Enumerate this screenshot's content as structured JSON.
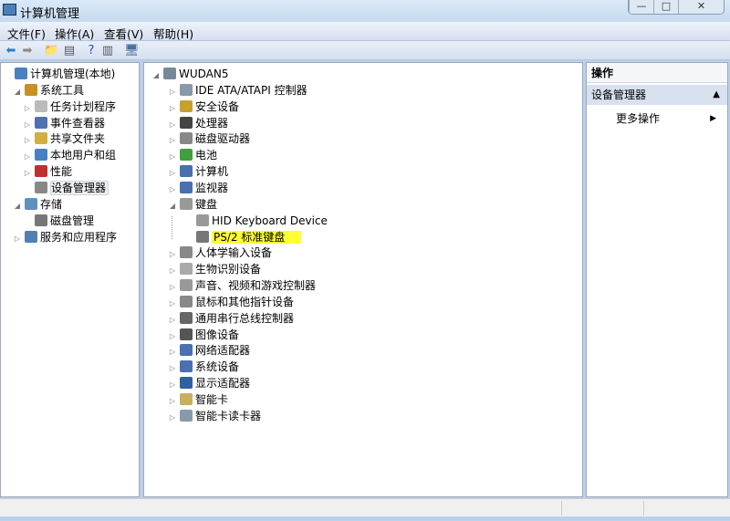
{
  "window": {
    "title": "计算机管理",
    "minimize": "—",
    "maximize": "□",
    "close": "✕"
  },
  "menu": [
    "文件(F)",
    "操作(A)",
    "查看(V)",
    "帮助(H)"
  ],
  "toolbar": [
    {
      "icon": "back-arrow-icon",
      "glyph": "⬅",
      "color": "#2a7fd0"
    },
    {
      "icon": "forward-arrow-icon",
      "glyph": "➡",
      "color": "#888888"
    },
    {
      "icon": "up-folder-icon",
      "glyph": "📁",
      "color": "#d8a030"
    },
    {
      "icon": "show-hide-console-tree-icon",
      "glyph": "▤",
      "color": "#556"
    },
    {
      "icon": "help-icon",
      "glyph": "?",
      "color": "#2b4fb0"
    },
    {
      "icon": "show-hide-action-pane-icon",
      "glyph": "▥",
      "color": "#556"
    },
    {
      "icon": "scan-hardware-icon",
      "glyph": "🖥",
      "color": "#4a6fa0"
    }
  ],
  "left_tree": [
    {
      "label": "计算机管理(本地)",
      "level": 0,
      "exp": "",
      "icon": "computer-management-icon",
      "color": "#4a7fc0"
    },
    {
      "label": "系统工具",
      "level": 1,
      "exp": "◢",
      "icon": "system-tools-icon",
      "color": "#c89020"
    },
    {
      "label": "任务计划程序",
      "level": 2,
      "exp": "▷",
      "icon": "task-scheduler-icon",
      "color": "#bbbbbb"
    },
    {
      "label": "事件查看器",
      "level": 2,
      "exp": "▷",
      "icon": "event-viewer-icon",
      "color": "#5070b0"
    },
    {
      "label": "共享文件夹",
      "level": 2,
      "exp": "▷",
      "icon": "shared-folders-icon",
      "color": "#d0b040"
    },
    {
      "label": "本地用户和组",
      "level": 2,
      "exp": "▷",
      "icon": "local-users-icon",
      "color": "#4a80c0"
    },
    {
      "label": "性能",
      "level": 2,
      "exp": "▷",
      "icon": "performance-icon",
      "color": "#c03030"
    },
    {
      "label": "设备管理器",
      "level": 2,
      "exp": "",
      "icon": "device-manager-icon",
      "color": "#888888",
      "selected": true
    },
    {
      "label": "存储",
      "level": 1,
      "exp": "◢",
      "icon": "storage-icon",
      "color": "#6090c0"
    },
    {
      "label": "磁盘管理",
      "level": 2,
      "exp": "",
      "icon": "disk-management-icon",
      "color": "#777777"
    },
    {
      "label": "服务和应用程序",
      "level": 1,
      "exp": "▷",
      "icon": "services-applications-icon",
      "color": "#5080b0"
    }
  ],
  "device_tree": [
    {
      "label": "WUDAN5",
      "level": 0,
      "exp": "◢",
      "icon": "computer-icon",
      "color": "#778899"
    },
    {
      "label": "IDE ATA/ATAPI 控制器",
      "level": 1,
      "exp": "▷",
      "icon": "ide-controller-icon",
      "color": "#8899aa"
    },
    {
      "label": "安全设备",
      "level": 1,
      "exp": "▷",
      "icon": "security-device-icon",
      "color": "#c8a030"
    },
    {
      "label": "处理器",
      "level": 1,
      "exp": "▷",
      "icon": "processor-icon",
      "color": "#444444"
    },
    {
      "label": "磁盘驱动器",
      "level": 1,
      "exp": "▷",
      "icon": "disk-drive-icon",
      "color": "#888888"
    },
    {
      "label": "电池",
      "level": 1,
      "exp": "▷",
      "icon": "battery-icon",
      "color": "#40a040"
    },
    {
      "label": "计算机",
      "level": 1,
      "exp": "▷",
      "icon": "computer-icon",
      "color": "#4a70b0"
    },
    {
      "label": "监视器",
      "level": 1,
      "exp": "▷",
      "icon": "monitor-icon",
      "color": "#4a70b0"
    },
    {
      "label": "键盘",
      "level": 1,
      "exp": "◢",
      "icon": "keyboard-icon",
      "color": "#999999"
    },
    {
      "label": "HID Keyboard Device",
      "level": 2,
      "exp": "",
      "icon": "keyboard-icon",
      "color": "#999999"
    },
    {
      "label": "PS/2 标准键盘",
      "level": 2,
      "exp": "",
      "icon": "keyboard-icon",
      "color": "#777777",
      "highlighted": true
    },
    {
      "label": "人体学输入设备",
      "level": 1,
      "exp": "▷",
      "icon": "hid-icon",
      "color": "#888888"
    },
    {
      "label": "生物识别设备",
      "level": 1,
      "exp": "▷",
      "icon": "biometric-icon",
      "color": "#aaaaaa"
    },
    {
      "label": "声音、视频和游戏控制器",
      "level": 1,
      "exp": "▷",
      "icon": "sound-icon",
      "color": "#999999"
    },
    {
      "label": "鼠标和其他指针设备",
      "level": 1,
      "exp": "▷",
      "icon": "mouse-icon",
      "color": "#888888"
    },
    {
      "label": "通用串行总线控制器",
      "level": 1,
      "exp": "▷",
      "icon": "usb-icon",
      "color": "#666666"
    },
    {
      "label": "图像设备",
      "level": 1,
      "exp": "▷",
      "icon": "imaging-device-icon",
      "color": "#555555"
    },
    {
      "label": "网络适配器",
      "level": 1,
      "exp": "▷",
      "icon": "network-adapter-icon",
      "color": "#4a70b0"
    },
    {
      "label": "系统设备",
      "level": 1,
      "exp": "▷",
      "icon": "system-device-icon",
      "color": "#4a70b0"
    },
    {
      "label": "显示适配器",
      "level": 1,
      "exp": "▷",
      "icon": "display-adapter-icon",
      "color": "#3060a0"
    },
    {
      "label": "智能卡",
      "level": 1,
      "exp": "▷",
      "icon": "smart-card-icon",
      "color": "#c8b060"
    },
    {
      "label": "智能卡读卡器",
      "level": 1,
      "exp": "▷",
      "icon": "smart-card-reader-icon",
      "color": "#8899aa"
    }
  ],
  "actions": {
    "header": "操作",
    "section": "设备管理器",
    "section_arrow": "▲",
    "more": "更多操作",
    "more_arrow": "▶"
  },
  "colors": {
    "highlight": "#ffff33",
    "action_section": "#d7e1f0"
  }
}
